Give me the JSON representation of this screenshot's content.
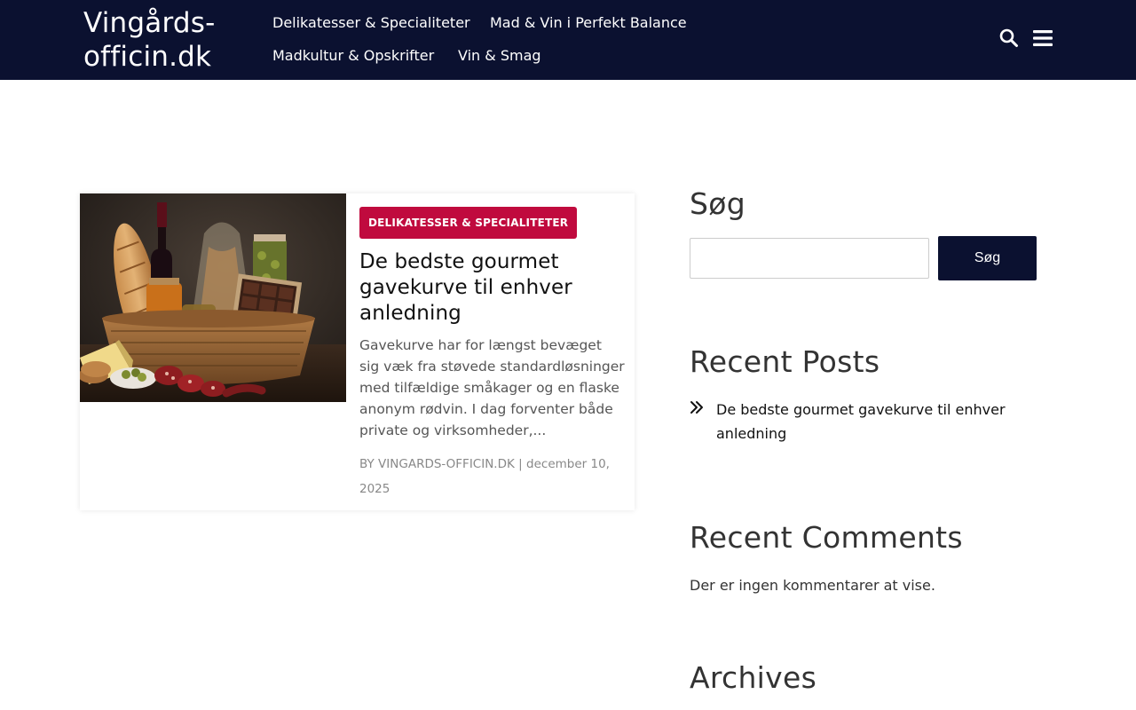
{
  "header": {
    "site_title": "Vingårds-\nofficin.dk",
    "nav": [
      {
        "label": "Delikatesser & Specialiteter"
      },
      {
        "label": "Mad & Vin i Perfekt Balance"
      },
      {
        "label": "Madkultur & Opskrifter"
      },
      {
        "label": "Vin & Smag"
      }
    ],
    "search_icon": "search-icon",
    "menu_icon": "hamburger-menu-icon"
  },
  "post": {
    "category": "DELIKATESSER & SPECIALITETER",
    "title": "De bedste gourmet gavekurve til enhver anledning",
    "excerpt": "Gavekurve har for længst bevæget sig væk fra støvede standardløsninger med tilfældige småkager og en flaske anonym rødvin. I dag forventer både private og virksomheder,...",
    "author": "BY VINGARDS-OFFICIN.DK",
    "separator": "|",
    "date": "december 10, 2025"
  },
  "sidebar": {
    "search": {
      "title": "Søg",
      "placeholder": "",
      "value": "",
      "button_label": "Søg"
    },
    "recent_posts": {
      "title": "Recent Posts",
      "items": [
        {
          "label": "De bedste gourmet gavekurve til enhver anledning"
        }
      ]
    },
    "recent_comments": {
      "title": "Recent Comments",
      "empty_text": "Der er ingen kommentarer at vise."
    },
    "archives": {
      "title": "Archives"
    }
  },
  "colors": {
    "header_bg": "#0b1130",
    "badge_bg": "#c00a3e",
    "button_bg": "#0b1130"
  }
}
